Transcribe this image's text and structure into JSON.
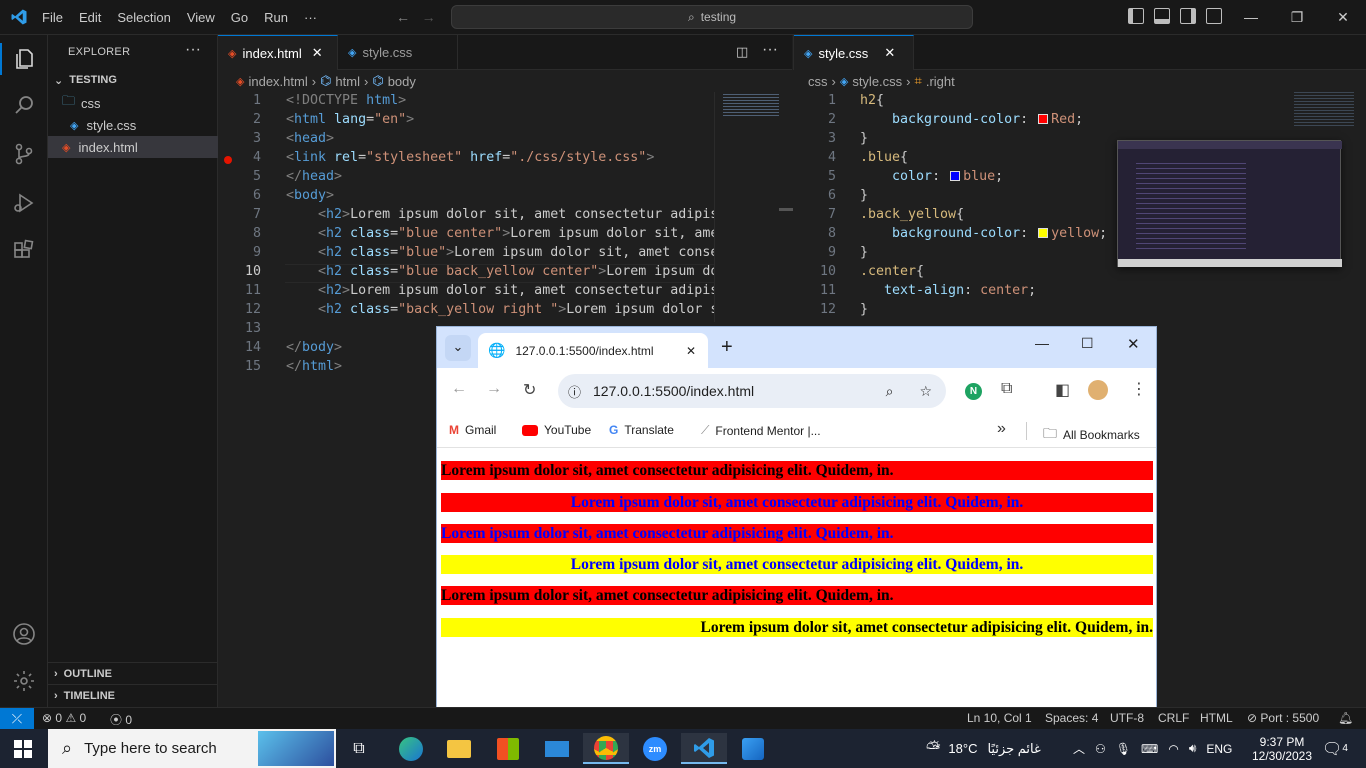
{
  "titlebar": {
    "menu": [
      "File",
      "Edit",
      "Selection",
      "View",
      "Go",
      "Run",
      "···"
    ],
    "search_text": "testing"
  },
  "sidebar": {
    "title": "EXPLORER",
    "project": "TESTING",
    "tree": [
      {
        "label": "css",
        "kind": "folder"
      },
      {
        "label": "style.css",
        "kind": "css"
      },
      {
        "label": "index.html",
        "kind": "html",
        "selected": true
      }
    ],
    "outline": "OUTLINE",
    "timeline": "TIMELINE"
  },
  "editor_left": {
    "tabs": [
      {
        "label": "index.html",
        "active": true
      },
      {
        "label": "style.css",
        "active": false
      }
    ],
    "breadcrumb": [
      "index.html",
      "html",
      "body"
    ],
    "current_line": 10,
    "breakpoint_line": 4,
    "lines": [
      [
        [
          "<!DOCTYPE ",
          "t-brk"
        ],
        [
          "html",
          "t-dt"
        ],
        [
          ">",
          "t-brk"
        ]
      ],
      [
        [
          "<",
          "t-brk"
        ],
        [
          "html",
          "t-tag"
        ],
        [
          " lang",
          "t-att"
        ],
        [
          "=",
          "t-txt"
        ],
        [
          "\"en\"",
          "t-str"
        ],
        [
          ">",
          "t-brk"
        ]
      ],
      [
        [
          "<",
          "t-brk"
        ],
        [
          "head",
          "t-tag"
        ],
        [
          ">",
          "t-brk"
        ]
      ],
      [
        [
          "<",
          "t-brk"
        ],
        [
          "link",
          "t-tag"
        ],
        [
          " rel",
          "t-att"
        ],
        [
          "=",
          "t-txt"
        ],
        [
          "\"stylesheet\"",
          "t-str"
        ],
        [
          " href",
          "t-att"
        ],
        [
          "=",
          "t-txt"
        ],
        [
          "\"./css/style.css\"",
          "t-str"
        ],
        [
          ">",
          "t-brk"
        ]
      ],
      [
        [
          "</",
          "t-brk"
        ],
        [
          "head",
          "t-tag"
        ],
        [
          ">",
          "t-brk"
        ]
      ],
      [
        [
          "<",
          "t-brk"
        ],
        [
          "body",
          "t-tag"
        ],
        [
          ">",
          "t-brk"
        ]
      ],
      [
        [
          "    <",
          "t-brk"
        ],
        [
          "h2",
          "t-tag"
        ],
        [
          ">",
          "t-brk"
        ],
        [
          "Lorem ipsum dolor sit, amet consectetur adipisic",
          "t-txt"
        ]
      ],
      [
        [
          "    <",
          "t-brk"
        ],
        [
          "h2",
          "t-tag"
        ],
        [
          " class",
          "t-att"
        ],
        [
          "=",
          "t-txt"
        ],
        [
          "\"blue center\"",
          "t-str"
        ],
        [
          ">",
          "t-brk"
        ],
        [
          "Lorem ipsum dolor sit, amet",
          "t-txt"
        ]
      ],
      [
        [
          "    <",
          "t-brk"
        ],
        [
          "h2",
          "t-tag"
        ],
        [
          " class",
          "t-att"
        ],
        [
          "=",
          "t-txt"
        ],
        [
          "\"blue\"",
          "t-str"
        ],
        [
          ">",
          "t-brk"
        ],
        [
          "Lorem ipsum dolor sit, amet consect",
          "t-txt"
        ]
      ],
      [
        [
          "    <",
          "t-brk"
        ],
        [
          "h2",
          "t-tag"
        ],
        [
          " class",
          "t-att"
        ],
        [
          "=",
          "t-txt"
        ],
        [
          "\"blue back_yellow center\"",
          "t-str"
        ],
        [
          ">",
          "t-brk"
        ],
        [
          "Lorem ipsum dolo",
          "t-txt"
        ]
      ],
      [
        [
          "    <",
          "t-brk"
        ],
        [
          "h2",
          "t-tag"
        ],
        [
          ">",
          "t-brk"
        ],
        [
          "Lorem ipsum dolor sit, amet consectetur adipisic",
          "t-txt"
        ]
      ],
      [
        [
          "    <",
          "t-brk"
        ],
        [
          "h2",
          "t-tag"
        ],
        [
          " class",
          "t-att"
        ],
        [
          "=",
          "t-txt"
        ],
        [
          "\"back_yellow right \"",
          "t-str"
        ],
        [
          ">",
          "t-brk"
        ],
        [
          "Lorem ipsum dolor sit",
          "t-txt"
        ]
      ],
      [],
      [
        [
          "</",
          "t-brk"
        ],
        [
          "body",
          "t-tag"
        ],
        [
          ">",
          "t-brk"
        ]
      ],
      [
        [
          "</",
          "t-brk"
        ],
        [
          "html",
          "t-tag"
        ],
        [
          ">",
          "t-brk"
        ]
      ]
    ]
  },
  "editor_right": {
    "tabs": [
      {
        "label": "style.css",
        "active": true
      }
    ],
    "breadcrumb": [
      "css",
      "style.css",
      ".right"
    ],
    "lines": [
      [
        [
          "h2",
          "t-sel"
        ],
        [
          "{",
          "t-pun"
        ]
      ],
      [
        [
          "    background-color",
          "t-prop"
        ],
        [
          ": ",
          "t-pun"
        ],
        [
          "#ff0000",
          "swatch"
        ],
        [
          "Red",
          "t-val"
        ],
        [
          ";",
          "t-pun"
        ]
      ],
      [
        [
          "}",
          "t-pun"
        ]
      ],
      [
        [
          ".blue",
          "t-sel"
        ],
        [
          "{",
          "t-pun"
        ]
      ],
      [
        [
          "    color",
          "t-prop"
        ],
        [
          ": ",
          "t-pun"
        ],
        [
          "#0000ff",
          "swatch"
        ],
        [
          "blue",
          "t-val"
        ],
        [
          ";",
          "t-pun"
        ]
      ],
      [
        [
          "}",
          "t-pun"
        ]
      ],
      [
        [
          ".back_yellow",
          "t-sel"
        ],
        [
          "{",
          "t-pun"
        ]
      ],
      [
        [
          "    background-color",
          "t-prop"
        ],
        [
          ": ",
          "t-pun"
        ],
        [
          "#ffff00",
          "swatch"
        ],
        [
          "yellow",
          "t-val"
        ],
        [
          ";",
          "t-pun"
        ]
      ],
      [
        [
          "}",
          "t-pun"
        ]
      ],
      [
        [
          ".center",
          "t-sel"
        ],
        [
          "{",
          "t-pun"
        ]
      ],
      [
        [
          "   text-align",
          "t-prop"
        ],
        [
          ": ",
          "t-pun"
        ],
        [
          "center",
          "t-val"
        ],
        [
          ";",
          "t-pun"
        ]
      ],
      [
        [
          "}",
          "t-pun"
        ]
      ]
    ]
  },
  "statusbar": {
    "errors": "0",
    "warnings": "0",
    "ports": "0",
    "position": "Ln 10, Col 1",
    "spaces": "Spaces: 4",
    "encoding": "UTF-8",
    "eol": "CRLF",
    "language": "HTML",
    "port": "Port : 5500"
  },
  "browser": {
    "tab_title": "127.0.0.1:5500/index.html",
    "url": "127.0.0.1:5500/index.html",
    "bookmarks": [
      "Gmail",
      "YouTube",
      "Translate",
      "Frontend Mentor |..."
    ],
    "all_bookmarks": "All Bookmarks",
    "headings": [
      {
        "text": "Lorem ipsum dolor sit, amet consectetur adipisicing elit. Quidem, in.",
        "color": "#000000",
        "bg": "#ff0000",
        "align": "left"
      },
      {
        "text": "Lorem ipsum dolor sit, amet consectetur adipisicing elit. Quidem, in.",
        "color": "#0000ff",
        "bg": "#ff0000",
        "align": "center"
      },
      {
        "text": "Lorem ipsum dolor sit, amet consectetur adipisicing elit. Quidem, in.",
        "color": "#0000ff",
        "bg": "#ff0000",
        "align": "left"
      },
      {
        "text": "Lorem ipsum dolor sit, amet consectetur adipisicing elit. Quidem, in.",
        "color": "#0000ff",
        "bg": "#ffff00",
        "align": "center"
      },
      {
        "text": "Lorem ipsum dolor sit, amet consectetur adipisicing elit. Quidem, in.",
        "color": "#000000",
        "bg": "#ff0000",
        "align": "left"
      },
      {
        "text": "Lorem ipsum dolor sit, amet consectetur adipisicing elit. Quidem, in.",
        "color": "#000000",
        "bg": "#ffff00",
        "align": "right"
      }
    ]
  },
  "taskbar": {
    "search_placeholder": "Type here to search",
    "weather": "18°C",
    "weather_text": "غائم جزئيًا",
    "language": "ENG",
    "time": "9:37 PM",
    "date": "12/30/2023",
    "notifications": "4"
  },
  "colors": {
    "accent": "#0078d4",
    "breakpoint": "#e51400"
  }
}
